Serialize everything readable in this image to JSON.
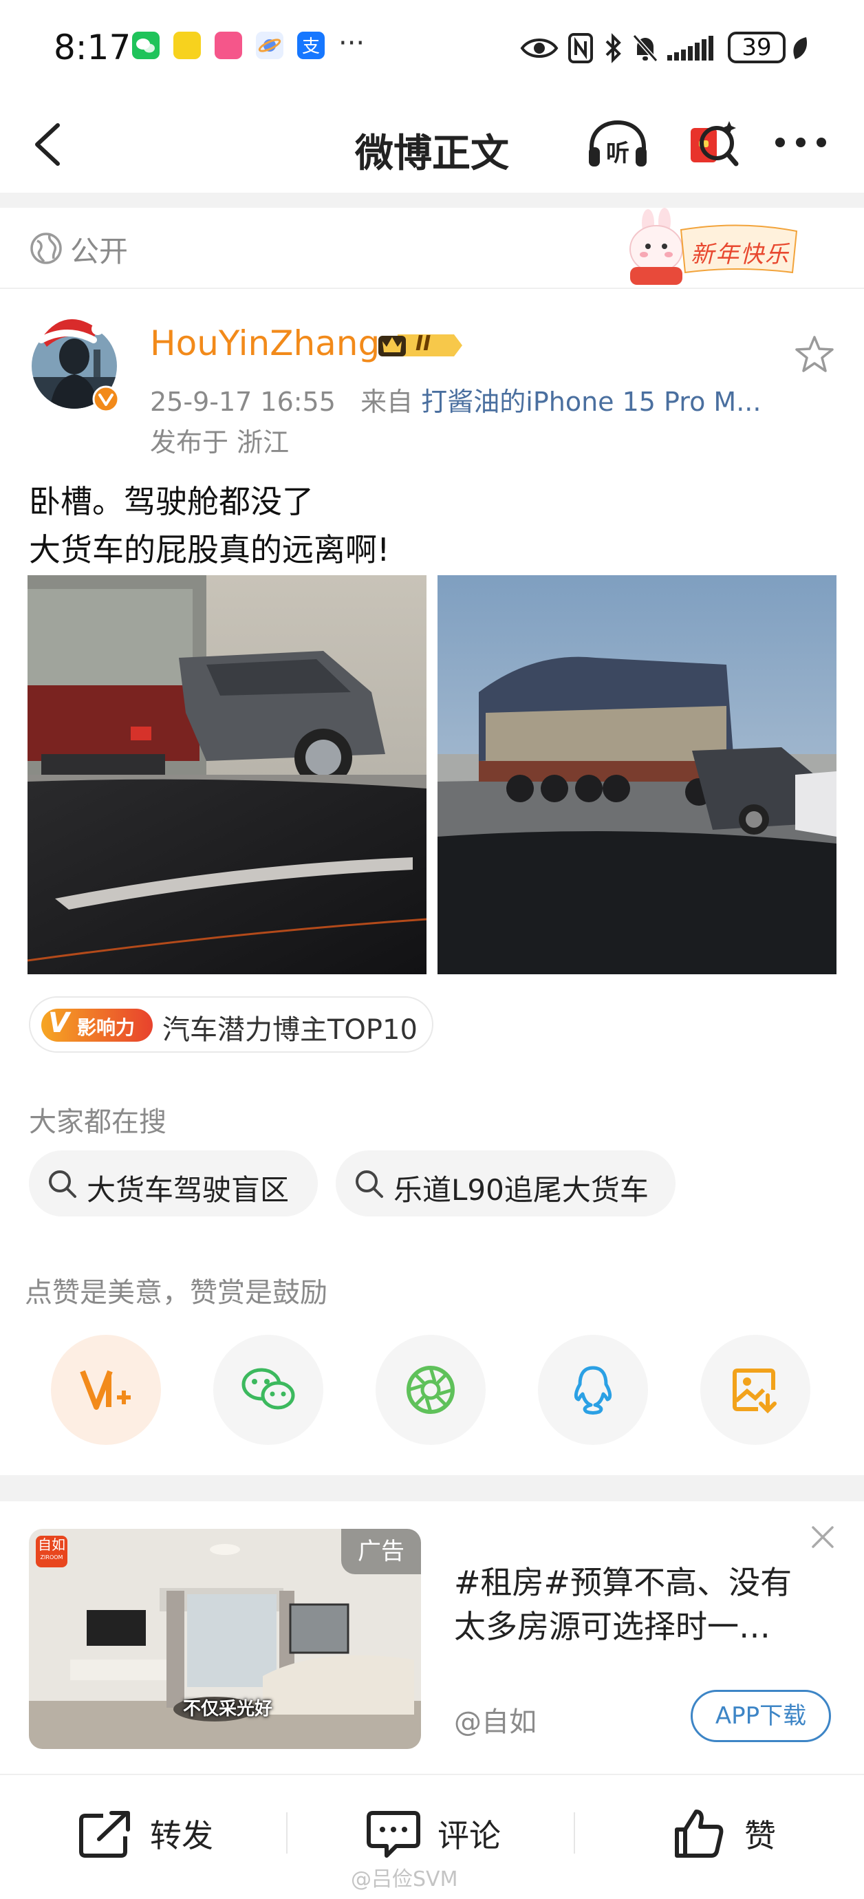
{
  "status_bar": {
    "time": "8:17",
    "more": "···",
    "battery": "39"
  },
  "nav": {
    "title": "微博正文",
    "listen_label": "听"
  },
  "visibility": {
    "label": "公开",
    "decoration_text": "新年快乐"
  },
  "post": {
    "author": "HouYinZhang",
    "level_badge": "II",
    "time": "25-9-17 16:55",
    "from_label": "来自",
    "source": "打酱油的iPhone 15 Pro M...",
    "location": "发布于 浙江",
    "text_lines": [
      "卧槽。驾驶舱都没了",
      "大货车的屁股真的远离啊!"
    ],
    "influence_badge": "影响力",
    "influence_text": "汽车潜力博主TOP10"
  },
  "search_section": {
    "title": "大家都在搜",
    "items": [
      "大货车驾驶盲区",
      "乐道L90追尾大货车"
    ]
  },
  "reward_section": {
    "title": "点赞是美意，赞赏是鼓励",
    "share_icons": [
      "v-plus-icon",
      "wechat-icon",
      "moments-icon",
      "qq-icon",
      "save-image-icon"
    ]
  },
  "ad": {
    "tag": "广告",
    "brand_logo": "自如",
    "brand_logo_sub": "ZIROOM",
    "image_caption": "不仅采光好",
    "title": "#租房#预算不高、没有太多房源可选择时一…",
    "title_line1": "#租房#预算不高、没有",
    "title_line2": "太多房源可选择时一…",
    "advertiser": "@自如",
    "cta": "APP下载"
  },
  "bottom_bar": {
    "repost": "转发",
    "comment": "评论",
    "like": "赞"
  },
  "watermark": "@吕俭SVM",
  "colors": {
    "accent_orange": "#f28a1a",
    "link_blue": "#4a6f9f",
    "cta_blue": "#3d85c6"
  }
}
